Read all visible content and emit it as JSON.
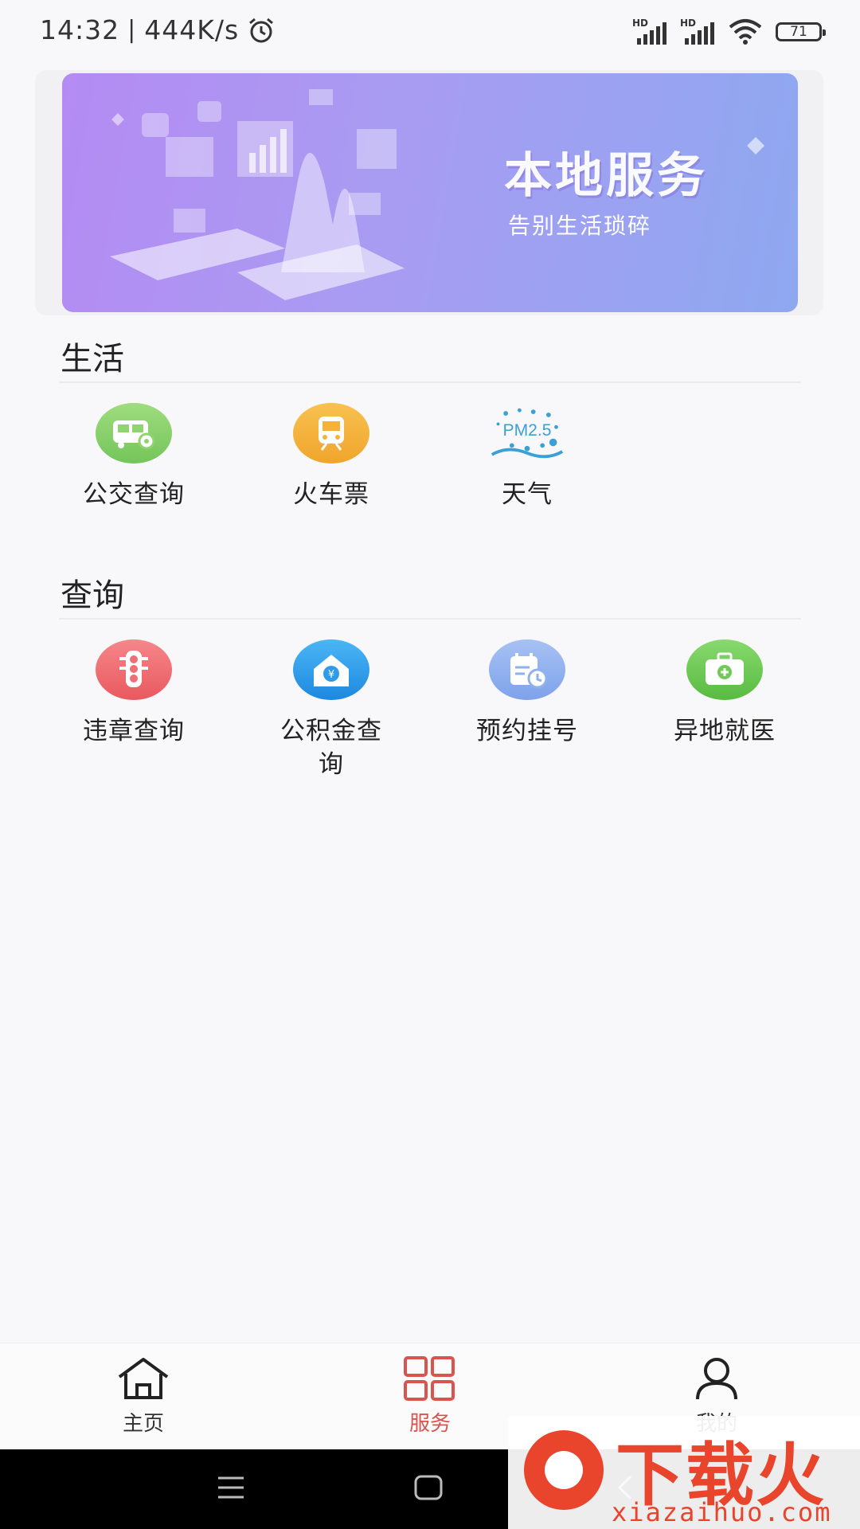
{
  "status_bar": {
    "time": "14:32",
    "network_speed": "444K/s",
    "battery": "71",
    "hd_1": "HD",
    "hd_2": "HD"
  },
  "banner": {
    "title": "本地服务",
    "subtitle": "告别生活琐碎"
  },
  "sections": {
    "life": {
      "title": "生活",
      "items": [
        {
          "label": "公交查询",
          "icon": "bus-icon",
          "color": "#8fd46e"
        },
        {
          "label": "火车票",
          "icon": "train-icon",
          "color": "#f5b23a"
        },
        {
          "label": "天气",
          "icon": "pm25-weather-icon",
          "icon_text": "PM2.5",
          "color": "#3aa0d6"
        }
      ]
    },
    "query": {
      "title": "查询",
      "items": [
        {
          "label": "违章查询",
          "icon": "traffic-light-icon",
          "color": "#ee6f74"
        },
        {
          "label": "公积金查询",
          "label_line1": "公积金查",
          "label_line2": "询",
          "icon": "housing-fund-icon",
          "color": "#2e9be8"
        },
        {
          "label": "预约挂号",
          "icon": "calendar-clock-icon",
          "color": "#8fb1ee"
        },
        {
          "label": "异地就医",
          "icon": "medical-kit-icon",
          "color": "#6fcb56"
        }
      ]
    }
  },
  "bottom_nav": {
    "items": [
      {
        "label": "主页",
        "icon": "home-icon"
      },
      {
        "label": "服务",
        "icon": "grid-icon",
        "active": true
      },
      {
        "label": "我的",
        "icon": "user-icon"
      }
    ],
    "active_color": "#d9534f"
  },
  "watermark": {
    "text": "下载火",
    "url": "xiazaihuo.com"
  }
}
